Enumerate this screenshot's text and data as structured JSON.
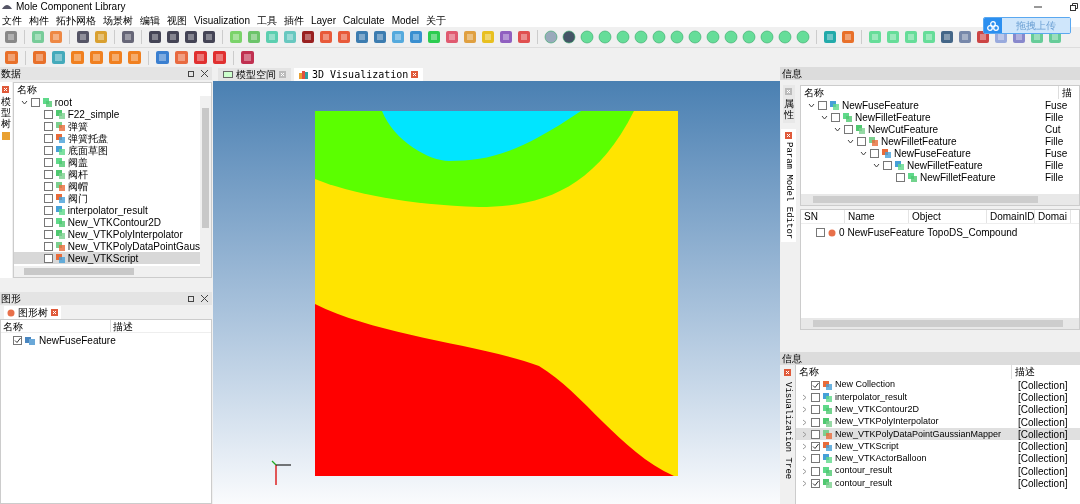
{
  "window": {
    "title": "Mole Component Library"
  },
  "menu": [
    "文件",
    "构件",
    "拓扑网格",
    "场景树",
    "编辑",
    "视图",
    "Visualization",
    "工具",
    "插件",
    "Layer",
    "Calculate",
    "Model",
    "关于"
  ],
  "upload_button": {
    "label": "拖拽上传"
  },
  "data_panel": {
    "title": "数据",
    "side_tab": "模型树",
    "column": "名称",
    "tree": [
      {
        "label": "root",
        "checked": false,
        "selected": false,
        "children": [
          {
            "label": "F22_simple",
            "checked": false,
            "selected": false
          },
          {
            "label": "弹簧",
            "checked": false,
            "selected": false
          },
          {
            "label": "弹簧托盘",
            "checked": false,
            "selected": false
          },
          {
            "label": "底面草图",
            "checked": false,
            "selected": false
          },
          {
            "label": "阀盖",
            "checked": false,
            "selected": false
          },
          {
            "label": "阀杆",
            "checked": false,
            "selected": false
          },
          {
            "label": "阀帽",
            "checked": false,
            "selected": false
          },
          {
            "label": "阀门",
            "checked": false,
            "selected": false
          },
          {
            "label": "interpolator_result",
            "checked": false,
            "selected": false
          },
          {
            "label": "New_VTKContour2D",
            "checked": false,
            "selected": false
          },
          {
            "label": "New_VTKPolyInterpolator",
            "checked": false,
            "selected": false
          },
          {
            "label": "New_VTKPolyDataPointGaus",
            "checked": false,
            "selected": false
          },
          {
            "label": "New_VTKScript",
            "checked": false,
            "selected": true
          }
        ]
      }
    ]
  },
  "shape_panel": {
    "title": "图形",
    "tab": "图形树",
    "columns": [
      "名称",
      "描述"
    ],
    "items": [
      {
        "label": "NewFuseFeature",
        "checked": true
      }
    ]
  },
  "viewport_tabs": [
    {
      "label": "模型空间",
      "selected": false
    },
    {
      "label": "3D Visualization",
      "selected": true
    }
  ],
  "info_panel": {
    "title": "信息",
    "side_tabs": [
      {
        "label": "属性",
        "selected": false
      },
      {
        "label": "Param Model Editor",
        "selected": true
      }
    ],
    "tree_columns": [
      "名称",
      "描"
    ],
    "tree": [
      {
        "label": "NewFuseFeature",
        "desc": "Fuse",
        "checked": false,
        "children": [
          {
            "label": "NewFilletFeature",
            "desc": "Fille",
            "checked": false,
            "children": [
              {
                "label": "NewCutFeature",
                "desc": "Cut",
                "checked": false,
                "children": [
                  {
                    "label": "NewFilletFeature",
                    "desc": "Fille",
                    "checked": false,
                    "children": [
                      {
                        "label": "NewFuseFeature",
                        "desc": "Fuse",
                        "checked": false,
                        "children": [
                          {
                            "label": "NewFilletFeature",
                            "desc": "Fille",
                            "checked": false,
                            "children": [
                              {
                                "label": "NewFilletFeature",
                                "desc": "Fille",
                                "checked": false
                              }
                            ]
                          }
                        ]
                      }
                    ]
                  }
                ]
              }
            ]
          }
        ]
      }
    ],
    "table": {
      "columns": [
        "SN",
        "Name",
        "Object",
        "DomainID",
        "Domai"
      ],
      "rows": [
        {
          "checked": false,
          "cells": [
            "0",
            "NewFuseFeature",
            "TopoDS_Compound"
          ]
        }
      ]
    }
  },
  "vis_panel": {
    "title": "信息",
    "side_tab": "Visualization Tree",
    "columns": [
      "名称",
      "描述"
    ],
    "rows": [
      {
        "label": "New Collection",
        "desc": "[Collection]",
        "checked": true,
        "expandable": false,
        "selected": false
      },
      {
        "label": "interpolator_result",
        "desc": "[Collection]",
        "checked": false,
        "expandable": true,
        "selected": false
      },
      {
        "label": "New_VTKContour2D",
        "desc": "[Collection]",
        "checked": false,
        "expandable": true,
        "selected": false
      },
      {
        "label": "New_VTKPolyInterpolator",
        "desc": "[Collection]",
        "checked": false,
        "expandable": true,
        "selected": false
      },
      {
        "label": "New_VTKPolyDataPointGaussianMapper",
        "desc": "[Collection]",
        "checked": false,
        "expandable": true,
        "selected": true
      },
      {
        "label": "New_VTKScript",
        "desc": "[Collection]",
        "checked": true,
        "expandable": true,
        "selected": false
      },
      {
        "label": "New_VTKActorBalloon",
        "desc": "[Collection]",
        "checked": false,
        "expandable": true,
        "selected": false
      },
      {
        "label": "contour_result",
        "desc": "[Collection]",
        "checked": false,
        "expandable": true,
        "selected": false
      },
      {
        "label": "contour_result",
        "desc": "[Collection]",
        "checked": true,
        "expandable": true,
        "selected": false
      }
    ]
  }
}
